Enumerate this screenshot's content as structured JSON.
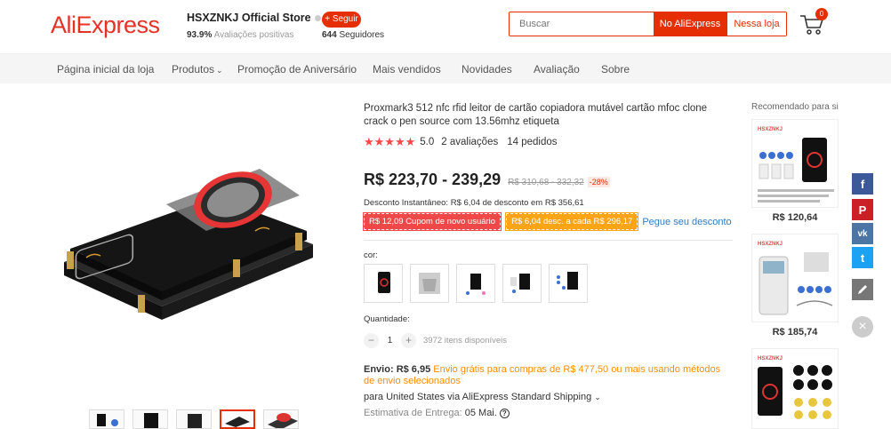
{
  "header": {
    "logo": "AliExpress",
    "store_name": "HSXZNKJ Official Store",
    "rating_value": "93.9%",
    "rating_label": "Avaliações positivas",
    "follow_label": "+ Seguir",
    "followers_count": "644",
    "followers_label": "Seguidores",
    "search_placeholder": "Buscar",
    "search_ali_label": "No AliExpress",
    "search_store_label": "Nessa loja",
    "cart_count": "0"
  },
  "nav": {
    "items": [
      {
        "label": "Página inicial da loja"
      },
      {
        "label": "Produtos"
      },
      {
        "label": "Promoção de Aniversário"
      },
      {
        "label": "Mais vendidos"
      },
      {
        "label": "Novidades"
      },
      {
        "label": "Avaliação"
      },
      {
        "label": "Sobre"
      }
    ]
  },
  "product": {
    "title": "Proxmark3 512 nfc rfid leitor de cartão copiadora mutável cartão mfoc clone crack o pen source com 13.56mhz etiqueta",
    "rating": "5.0",
    "reviews": "2 avaliações",
    "orders": "14 pedidos",
    "price": "R$ 223,70 - 239,29",
    "old_price": "R$ 310,68 - 332,32",
    "discount": "-28%",
    "instant_discount": "Desconto Instantâneo: R$ 6,04 de desconto em R$ 356,61",
    "coupon_new_user": "R$ 12,09 Cupom de novo usuário",
    "coupon_store": "R$ 6,04 desc. a cada R$ 296,17",
    "coupon_link": "Pegue seu desconto",
    "color_label": "cor:",
    "quantity_label": "Quantidade:",
    "quantity": "1",
    "available": "3972 itens disponíveis",
    "shipping_label": "Envio:",
    "shipping_price": "R$ 6,95",
    "shipping_free": "Envio grátis para compras de R$ 477,50 ou mais usando métodos de envio selecionados",
    "shipping_via": "para United States via AliExpress Standard Shipping",
    "estimate_label": "Estimativa de Entrega:",
    "estimate_value": "05 Mai."
  },
  "recommended": {
    "title": "Recomendado para si",
    "items": [
      {
        "price": "R$ 120,64",
        "brand": "HSXZNKJ"
      },
      {
        "price": "R$ 185,74",
        "brand": "HSXZNKJ"
      },
      {
        "price": "",
        "brand": "HSXZNKJ"
      }
    ]
  },
  "social": {
    "facebook": "f",
    "pinterest": "P",
    "vk": "vk",
    "twitter": "t",
    "close": "×"
  },
  "colors": {
    "brand": "#e43225",
    "accent": "#e62e04",
    "star": "#ff4747",
    "link": "#2e7bc4",
    "orange": "#ff8e00"
  }
}
